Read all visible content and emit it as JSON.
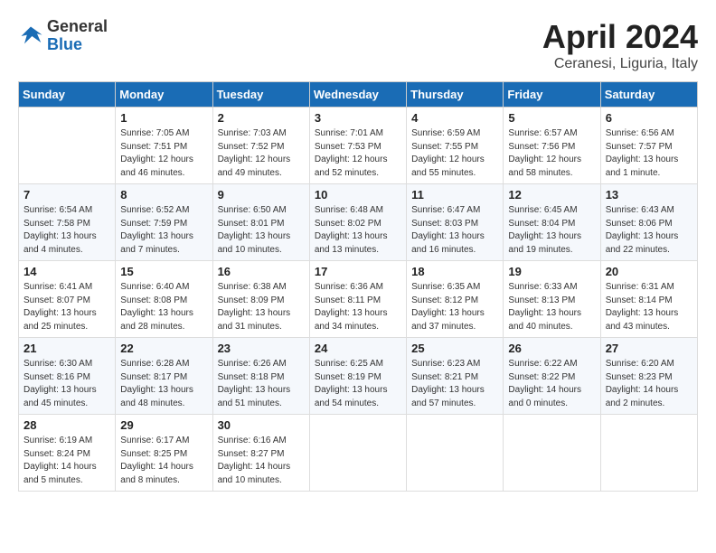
{
  "header": {
    "logo_general": "General",
    "logo_blue": "Blue",
    "title": "April 2024",
    "location": "Ceranesi, Liguria, Italy"
  },
  "days_of_week": [
    "Sunday",
    "Monday",
    "Tuesday",
    "Wednesday",
    "Thursday",
    "Friday",
    "Saturday"
  ],
  "weeks": [
    [
      {
        "day": "",
        "info": ""
      },
      {
        "day": "1",
        "info": "Sunrise: 7:05 AM\nSunset: 7:51 PM\nDaylight: 12 hours\nand 46 minutes."
      },
      {
        "day": "2",
        "info": "Sunrise: 7:03 AM\nSunset: 7:52 PM\nDaylight: 12 hours\nand 49 minutes."
      },
      {
        "day": "3",
        "info": "Sunrise: 7:01 AM\nSunset: 7:53 PM\nDaylight: 12 hours\nand 52 minutes."
      },
      {
        "day": "4",
        "info": "Sunrise: 6:59 AM\nSunset: 7:55 PM\nDaylight: 12 hours\nand 55 minutes."
      },
      {
        "day": "5",
        "info": "Sunrise: 6:57 AM\nSunset: 7:56 PM\nDaylight: 12 hours\nand 58 minutes."
      },
      {
        "day": "6",
        "info": "Sunrise: 6:56 AM\nSunset: 7:57 PM\nDaylight: 13 hours\nand 1 minute."
      }
    ],
    [
      {
        "day": "7",
        "info": "Sunrise: 6:54 AM\nSunset: 7:58 PM\nDaylight: 13 hours\nand 4 minutes."
      },
      {
        "day": "8",
        "info": "Sunrise: 6:52 AM\nSunset: 7:59 PM\nDaylight: 13 hours\nand 7 minutes."
      },
      {
        "day": "9",
        "info": "Sunrise: 6:50 AM\nSunset: 8:01 PM\nDaylight: 13 hours\nand 10 minutes."
      },
      {
        "day": "10",
        "info": "Sunrise: 6:48 AM\nSunset: 8:02 PM\nDaylight: 13 hours\nand 13 minutes."
      },
      {
        "day": "11",
        "info": "Sunrise: 6:47 AM\nSunset: 8:03 PM\nDaylight: 13 hours\nand 16 minutes."
      },
      {
        "day": "12",
        "info": "Sunrise: 6:45 AM\nSunset: 8:04 PM\nDaylight: 13 hours\nand 19 minutes."
      },
      {
        "day": "13",
        "info": "Sunrise: 6:43 AM\nSunset: 8:06 PM\nDaylight: 13 hours\nand 22 minutes."
      }
    ],
    [
      {
        "day": "14",
        "info": "Sunrise: 6:41 AM\nSunset: 8:07 PM\nDaylight: 13 hours\nand 25 minutes."
      },
      {
        "day": "15",
        "info": "Sunrise: 6:40 AM\nSunset: 8:08 PM\nDaylight: 13 hours\nand 28 minutes."
      },
      {
        "day": "16",
        "info": "Sunrise: 6:38 AM\nSunset: 8:09 PM\nDaylight: 13 hours\nand 31 minutes."
      },
      {
        "day": "17",
        "info": "Sunrise: 6:36 AM\nSunset: 8:11 PM\nDaylight: 13 hours\nand 34 minutes."
      },
      {
        "day": "18",
        "info": "Sunrise: 6:35 AM\nSunset: 8:12 PM\nDaylight: 13 hours\nand 37 minutes."
      },
      {
        "day": "19",
        "info": "Sunrise: 6:33 AM\nSunset: 8:13 PM\nDaylight: 13 hours\nand 40 minutes."
      },
      {
        "day": "20",
        "info": "Sunrise: 6:31 AM\nSunset: 8:14 PM\nDaylight: 13 hours\nand 43 minutes."
      }
    ],
    [
      {
        "day": "21",
        "info": "Sunrise: 6:30 AM\nSunset: 8:16 PM\nDaylight: 13 hours\nand 45 minutes."
      },
      {
        "day": "22",
        "info": "Sunrise: 6:28 AM\nSunset: 8:17 PM\nDaylight: 13 hours\nand 48 minutes."
      },
      {
        "day": "23",
        "info": "Sunrise: 6:26 AM\nSunset: 8:18 PM\nDaylight: 13 hours\nand 51 minutes."
      },
      {
        "day": "24",
        "info": "Sunrise: 6:25 AM\nSunset: 8:19 PM\nDaylight: 13 hours\nand 54 minutes."
      },
      {
        "day": "25",
        "info": "Sunrise: 6:23 AM\nSunset: 8:21 PM\nDaylight: 13 hours\nand 57 minutes."
      },
      {
        "day": "26",
        "info": "Sunrise: 6:22 AM\nSunset: 8:22 PM\nDaylight: 14 hours\nand 0 minutes."
      },
      {
        "day": "27",
        "info": "Sunrise: 6:20 AM\nSunset: 8:23 PM\nDaylight: 14 hours\nand 2 minutes."
      }
    ],
    [
      {
        "day": "28",
        "info": "Sunrise: 6:19 AM\nSunset: 8:24 PM\nDaylight: 14 hours\nand 5 minutes."
      },
      {
        "day": "29",
        "info": "Sunrise: 6:17 AM\nSunset: 8:25 PM\nDaylight: 14 hours\nand 8 minutes."
      },
      {
        "day": "30",
        "info": "Sunrise: 6:16 AM\nSunset: 8:27 PM\nDaylight: 14 hours\nand 10 minutes."
      },
      {
        "day": "",
        "info": ""
      },
      {
        "day": "",
        "info": ""
      },
      {
        "day": "",
        "info": ""
      },
      {
        "day": "",
        "info": ""
      }
    ]
  ]
}
